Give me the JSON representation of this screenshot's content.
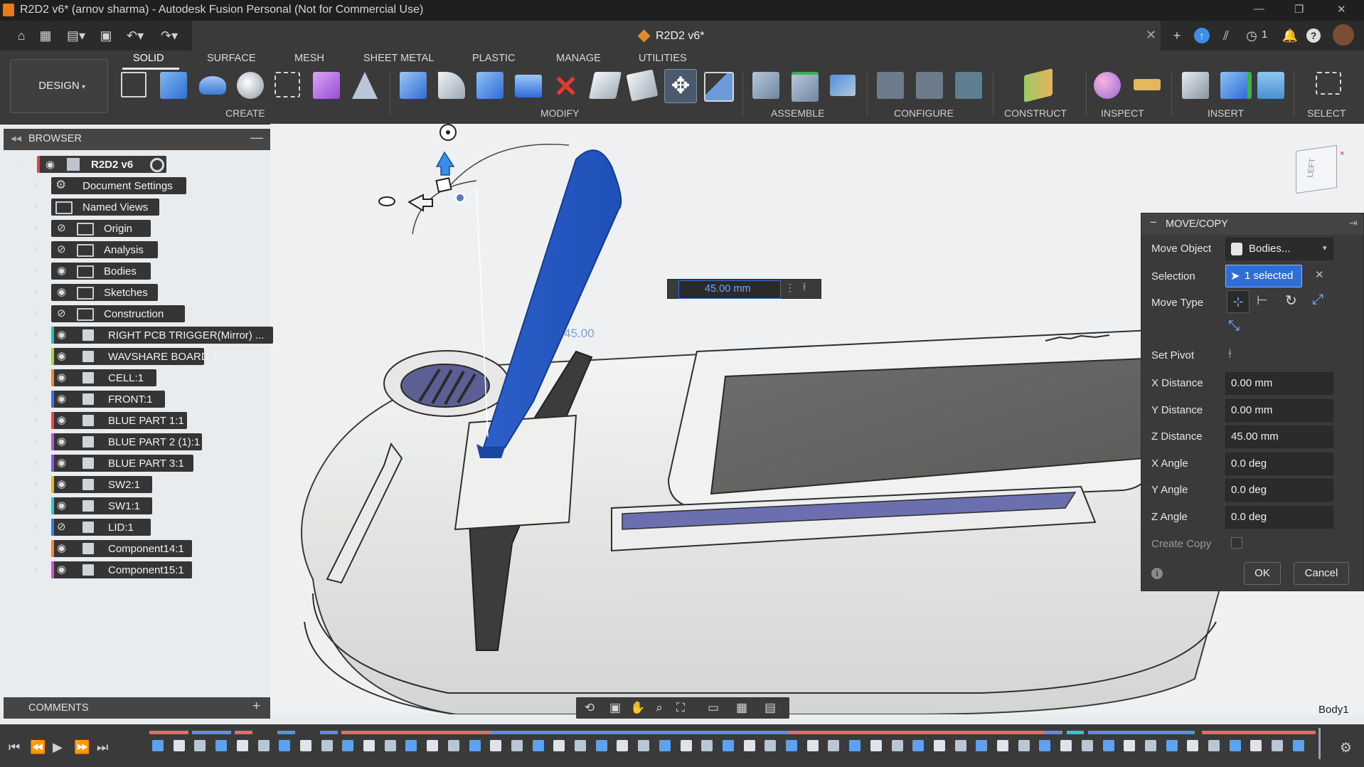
{
  "window": {
    "title": "R2D2 v6* (arnov sharma) - Autodesk Fusion Personal (Not for Commercial Use)",
    "controls": [
      "—",
      "❐",
      "✕"
    ]
  },
  "document_tab": {
    "name": "R2D2 v6*"
  },
  "tab_bar": {
    "notifications_count": "1"
  },
  "ribbon": {
    "workspace": "DESIGN",
    "tabs": [
      "SOLID",
      "SURFACE",
      "MESH",
      "SHEET METAL",
      "PLASTIC",
      "MANAGE",
      "UTILITIES"
    ],
    "active_tab": "SOLID",
    "groups": [
      "CREATE",
      "MODIFY",
      "ASSEMBLE",
      "CONFIGURE",
      "CONSTRUCT",
      "INSPECT",
      "INSERT",
      "SELECT"
    ]
  },
  "browser": {
    "title": "BROWSER",
    "root": "R2D2 v6",
    "items": [
      {
        "label": "Document Settings",
        "icon": "gear-icon",
        "visible": null,
        "stripe": ""
      },
      {
        "label": "Named Views",
        "icon": "folder-icon",
        "visible": null,
        "stripe": ""
      },
      {
        "label": "Origin",
        "icon": "folder-icon",
        "visible": false,
        "stripe": ""
      },
      {
        "label": "Analysis",
        "icon": "folder-icon",
        "visible": false,
        "stripe": ""
      },
      {
        "label": "Bodies",
        "icon": "folder-icon",
        "visible": true,
        "stripe": ""
      },
      {
        "label": "Sketches",
        "icon": "folder-icon",
        "visible": true,
        "stripe": ""
      },
      {
        "label": "Construction",
        "icon": "folder-icon",
        "visible": false,
        "stripe": ""
      },
      {
        "label": "RIGHT PCB TRIGGER(Mirror) ...",
        "icon": "component-icon",
        "visible": true,
        "stripe": "#3fb7a6"
      },
      {
        "label": "WAVSHARE BOARD:1",
        "icon": "component-icon",
        "visible": true,
        "stripe": "#a6d14a"
      },
      {
        "label": "CELL:1",
        "icon": "component-icon",
        "visible": true,
        "stripe": "#e88b3a"
      },
      {
        "label": "FRONT:1",
        "icon": "component-icon",
        "visible": true,
        "stripe": "#4d6bd6"
      },
      {
        "label": "BLUE PART 1:1",
        "icon": "component-icon",
        "visible": true,
        "stripe": "#e24a52"
      },
      {
        "label": "BLUE PART 2 (1):1",
        "icon": "component-icon",
        "visible": true,
        "stripe": "#b05ad0"
      },
      {
        "label": "BLUE PART 3:1",
        "icon": "component-icon",
        "visible": true,
        "stripe": "#7f5ed6"
      },
      {
        "label": "SW2:1",
        "icon": "component-icon",
        "visible": true,
        "stripe": "#e8b13a"
      },
      {
        "label": "SW1:1",
        "icon": "component-icon",
        "visible": true,
        "stripe": "#3fc1cc"
      },
      {
        "label": "LID:1",
        "icon": "component-icon",
        "visible": false,
        "stripe": "#3a7fd6"
      },
      {
        "label": "Component14:1",
        "icon": "component-icon",
        "visible": true,
        "stripe": "#e88b3a"
      },
      {
        "label": "Component15:1",
        "icon": "component-icon",
        "visible": true,
        "stripe": "#c85ac8"
      }
    ]
  },
  "viewport": {
    "distance_input": "45.00 mm",
    "ghost_label": "45.00",
    "viewcube_face": "LEFT",
    "body_label": "Body1"
  },
  "move_copy": {
    "title": "MOVE/COPY",
    "move_object_label": "Move Object",
    "move_object_value": "Bodies...",
    "selection_label": "Selection",
    "selection_value": "1 selected",
    "move_type_label": "Move Type",
    "set_pivot_label": "Set Pivot",
    "fields": [
      {
        "label": "X Distance",
        "value": "0.00 mm"
      },
      {
        "label": "Y Distance",
        "value": "0.00 mm"
      },
      {
        "label": "Z Distance",
        "value": "45.00 mm"
      },
      {
        "label": "X Angle",
        "value": "0.0 deg"
      },
      {
        "label": "Y Angle",
        "value": "0.0 deg"
      },
      {
        "label": "Z Angle",
        "value": "0.0 deg"
      }
    ],
    "create_copy_label": "Create Copy",
    "create_copy_checked": false,
    "ok": "OK",
    "cancel": "Cancel"
  },
  "comments": {
    "title": "COMMENTS"
  },
  "colors": {
    "accent_blue": "#1f66d6",
    "part_blue": "#2f6bd9",
    "panel": "#3a3a3a"
  }
}
